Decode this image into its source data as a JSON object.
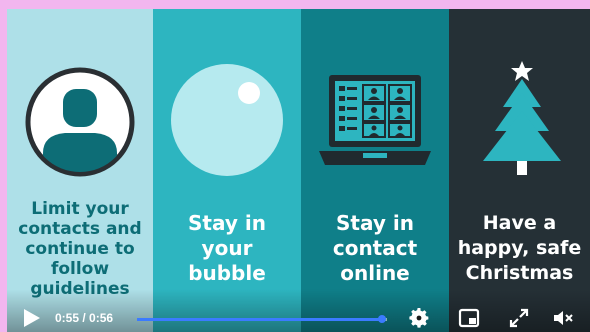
{
  "panels": [
    {
      "caption_lines": [
        "Limit your",
        "contacts and",
        "continue to",
        "follow",
        "guidelines"
      ],
      "icon": "person-icon"
    },
    {
      "caption_lines": [
        "Stay in",
        "your",
        "bubble"
      ],
      "icon": "bubble-icon"
    },
    {
      "caption_lines": [
        "Stay in",
        "contact",
        "online"
      ],
      "icon": "laptop-video-call-icon"
    },
    {
      "caption_lines": [
        "Have a",
        "happy, safe",
        "Christmas"
      ],
      "icon": "christmas-tree-icon"
    }
  ],
  "player": {
    "time_display": "0:55 / 0:56",
    "progress": 0.98,
    "icons": [
      "play-icon",
      "settings-gear-icon",
      "miniplayer-icon",
      "fullscreen-icon",
      "volume-muted-icon"
    ]
  },
  "colors": {
    "panel1": "#aee0e8",
    "panel2": "#2db5c0",
    "panel3": "#0f7f89",
    "panel4": "#253036",
    "teal_dark": "#0d6d76",
    "progress": "#3b7bff"
  }
}
